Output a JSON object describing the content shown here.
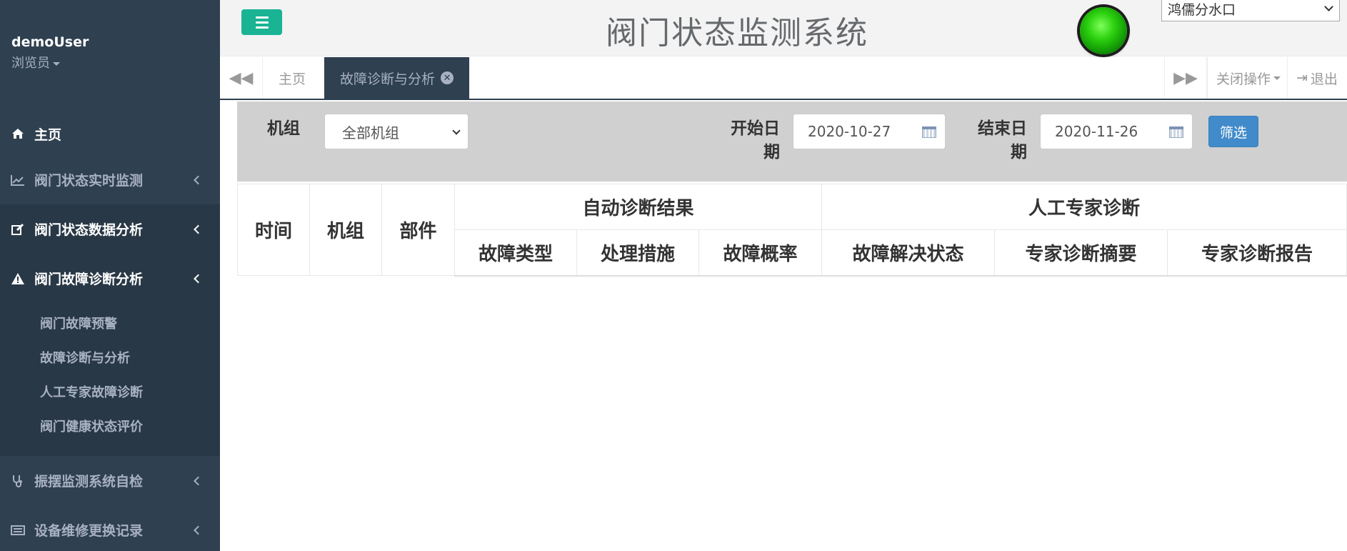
{
  "user": {
    "name": "demoUser",
    "role": "浏览员"
  },
  "sidebar": {
    "items": [
      {
        "label": "主页",
        "icon": "home-icon"
      },
      {
        "label": "阀门状态实时监测",
        "icon": "line-chart-icon"
      },
      {
        "label": "阀门状态数据分析",
        "icon": "edit-icon"
      },
      {
        "label": "阀门故障诊断分析",
        "icon": "warning-icon"
      },
      {
        "label": "振摆监测系统自检",
        "icon": "stethoscope-icon"
      },
      {
        "label": "设备维修更换记录",
        "icon": "list-icon"
      }
    ],
    "submenu": [
      "阀门故障预警",
      "故障诊断与分析",
      "人工专家故障诊断",
      "阀门健康状态评价"
    ]
  },
  "header": {
    "title": "阀门状态监测系统",
    "station": "鸿儒分水口",
    "status_color": "#2cd10e"
  },
  "tabs": {
    "home": "主页",
    "active": "故障诊断与分析",
    "close_ops": "关闭操作",
    "logout": "退出"
  },
  "filter": {
    "unit_label": "机组",
    "unit_value": "全部机组",
    "start_label_1": "开始日",
    "start_label_2": "期",
    "start_value": "2020-10-27",
    "end_label_1": "结束日",
    "end_label_2": "期",
    "end_value": "2020-11-26",
    "filter_button": "筛选"
  },
  "table": {
    "col_time": "时间",
    "col_unit": "机组",
    "col_part": "部件",
    "group_auto": "自动诊断结果",
    "group_expert": "人工专家诊断",
    "fault_type": "故障类型",
    "measure": "处理措施",
    "probability": "故障概率",
    "resolve_status": "故障解决状态",
    "summary": "专家诊断摘要",
    "report": "专家诊断报告"
  },
  "colors": {
    "sidebar_bg": "#2f4050",
    "accent": "#1ab394",
    "button_primary": "#428bca"
  }
}
